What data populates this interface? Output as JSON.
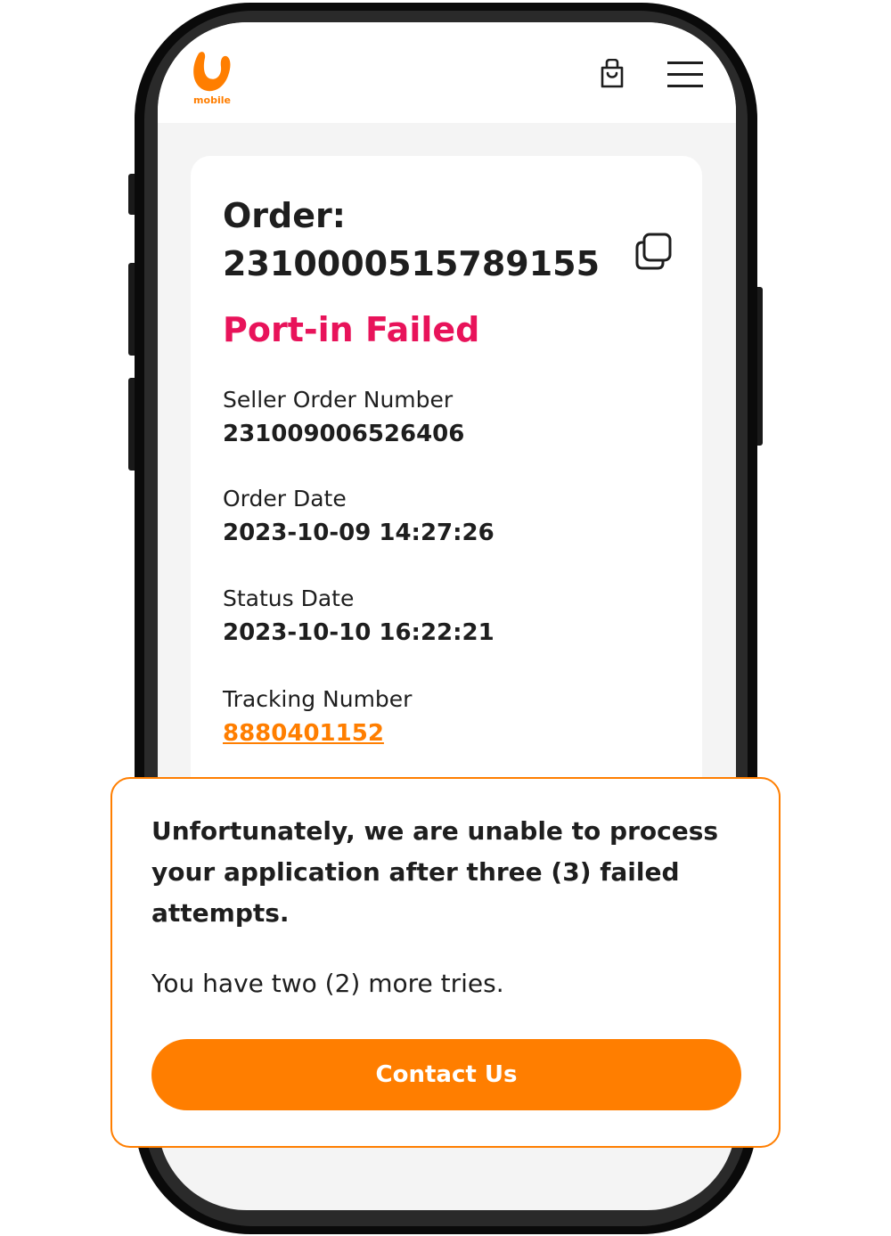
{
  "app": {
    "logo_text": "mobile",
    "brand_color": "#ff7e00",
    "status_color": "#e8135a"
  },
  "header": {
    "cart_icon": "shopping-bag-icon",
    "menu_icon": "hamburger-menu-icon"
  },
  "order": {
    "title_label": "Order:",
    "order_number": "2310000515789155",
    "copy_icon": "copy-icon",
    "status": "Port-in Failed",
    "fields": [
      {
        "label": "Seller Order Number",
        "value": "231009006526406"
      },
      {
        "label": "Order Date",
        "value": "2023-10-09 14:27:26"
      },
      {
        "label": "Status Date",
        "value": "2023-10-10 16:22:21"
      },
      {
        "label": "Tracking Number",
        "value": "8880401152"
      }
    ]
  },
  "popup": {
    "message": "Unfortunately, we are unable to process your application after three (3) failed attempts.",
    "sub_message": "You have two (2) more tries.",
    "button_label": "Contact Us"
  }
}
